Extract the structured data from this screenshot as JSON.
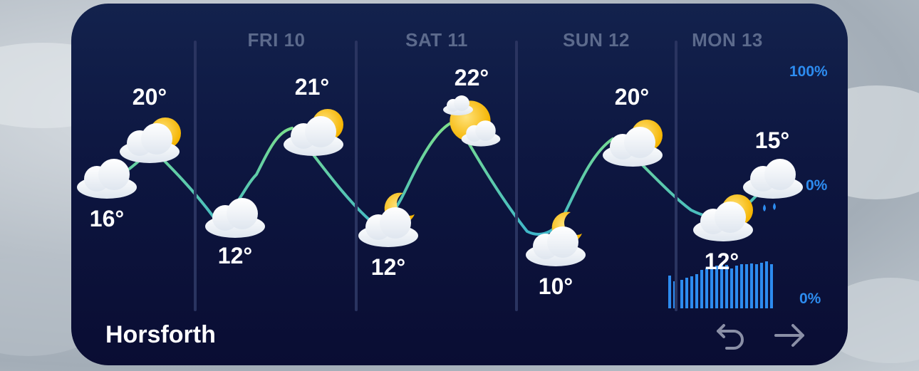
{
  "location": "Horsforth",
  "days": [
    {
      "label": "FRI 10"
    },
    {
      "label": "SAT 11"
    },
    {
      "label": "SUN 12"
    },
    {
      "label": "MON 13"
    }
  ],
  "temperatures": [
    {
      "value": "16°",
      "icon": "cloud-icon"
    },
    {
      "value": "20°",
      "icon": "partly-sunny-icon"
    },
    {
      "value": "12°",
      "icon": "cloud-icon"
    },
    {
      "value": "21°",
      "icon": "partly-sunny-icon"
    },
    {
      "value": "12°",
      "icon": "partly-cloudy-night-icon"
    },
    {
      "value": "22°",
      "icon": "sun-behind-clouds-icon"
    },
    {
      "value": "10°",
      "icon": "partly-cloudy-night-icon"
    },
    {
      "value": "20°",
      "icon": "partly-sunny-icon"
    },
    {
      "value": "12°",
      "icon": "partly-sunny-icon"
    },
    {
      "value": "15°",
      "icon": "rain-cloud-icon"
    }
  ],
  "precipitation": {
    "scale_top": "100%",
    "scale_mid": "0%",
    "scale_bottom": "0%",
    "bar_color": "#2d8cf0"
  },
  "colors": {
    "curve_start": "#7ee08a",
    "curve_end": "#3fb7c9",
    "background_top": "#13224d",
    "background_bottom": "#0a0d33"
  },
  "controls": {
    "back_icon": "undo-arrow-icon",
    "next_icon": "right-arrow-icon"
  }
}
